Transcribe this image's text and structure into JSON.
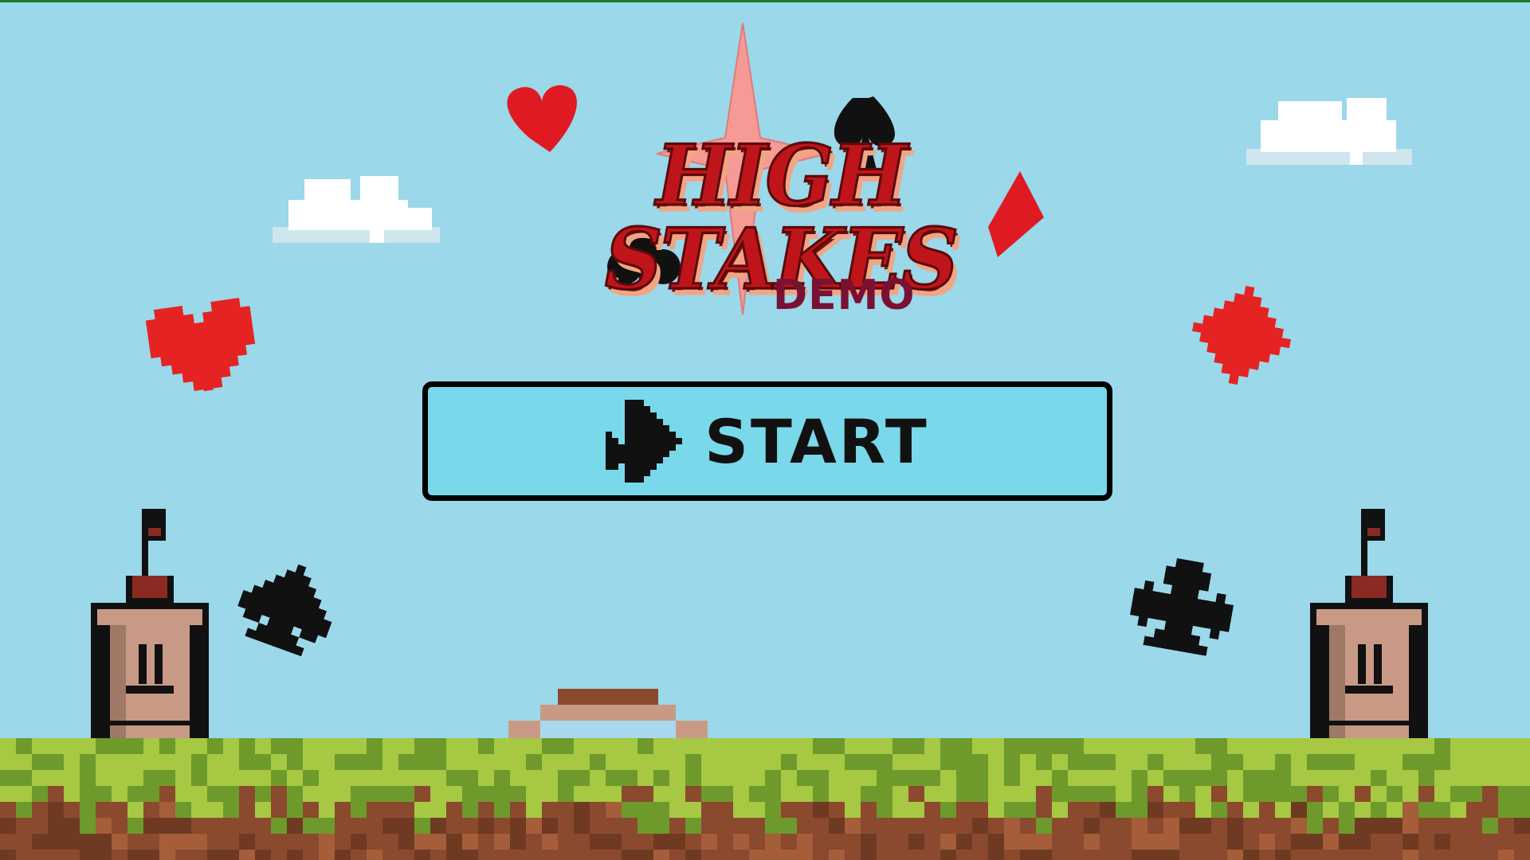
{
  "game": {
    "title": "HIGH STAKES",
    "subtitle": "DEMO"
  },
  "start_button": {
    "label": "START",
    "icon": "pixel-spade-arrow-icon"
  },
  "colors": {
    "sky": "#9ad8ea",
    "button_fill": "#79d8ea",
    "title_red": "#c0141b",
    "subtitle": "#7a1133",
    "grass_light": "#a6c843",
    "grass_dark": "#6e9a2c",
    "dirt": "#8b4a2e",
    "heart_red": "#e62323",
    "water": "#2bb3e8"
  },
  "decorations": [
    "cloud-left",
    "cloud-right",
    "pixel-heart",
    "pixel-diamond",
    "pixel-spade",
    "pixel-club",
    "tower-left",
    "tower-right",
    "well"
  ]
}
